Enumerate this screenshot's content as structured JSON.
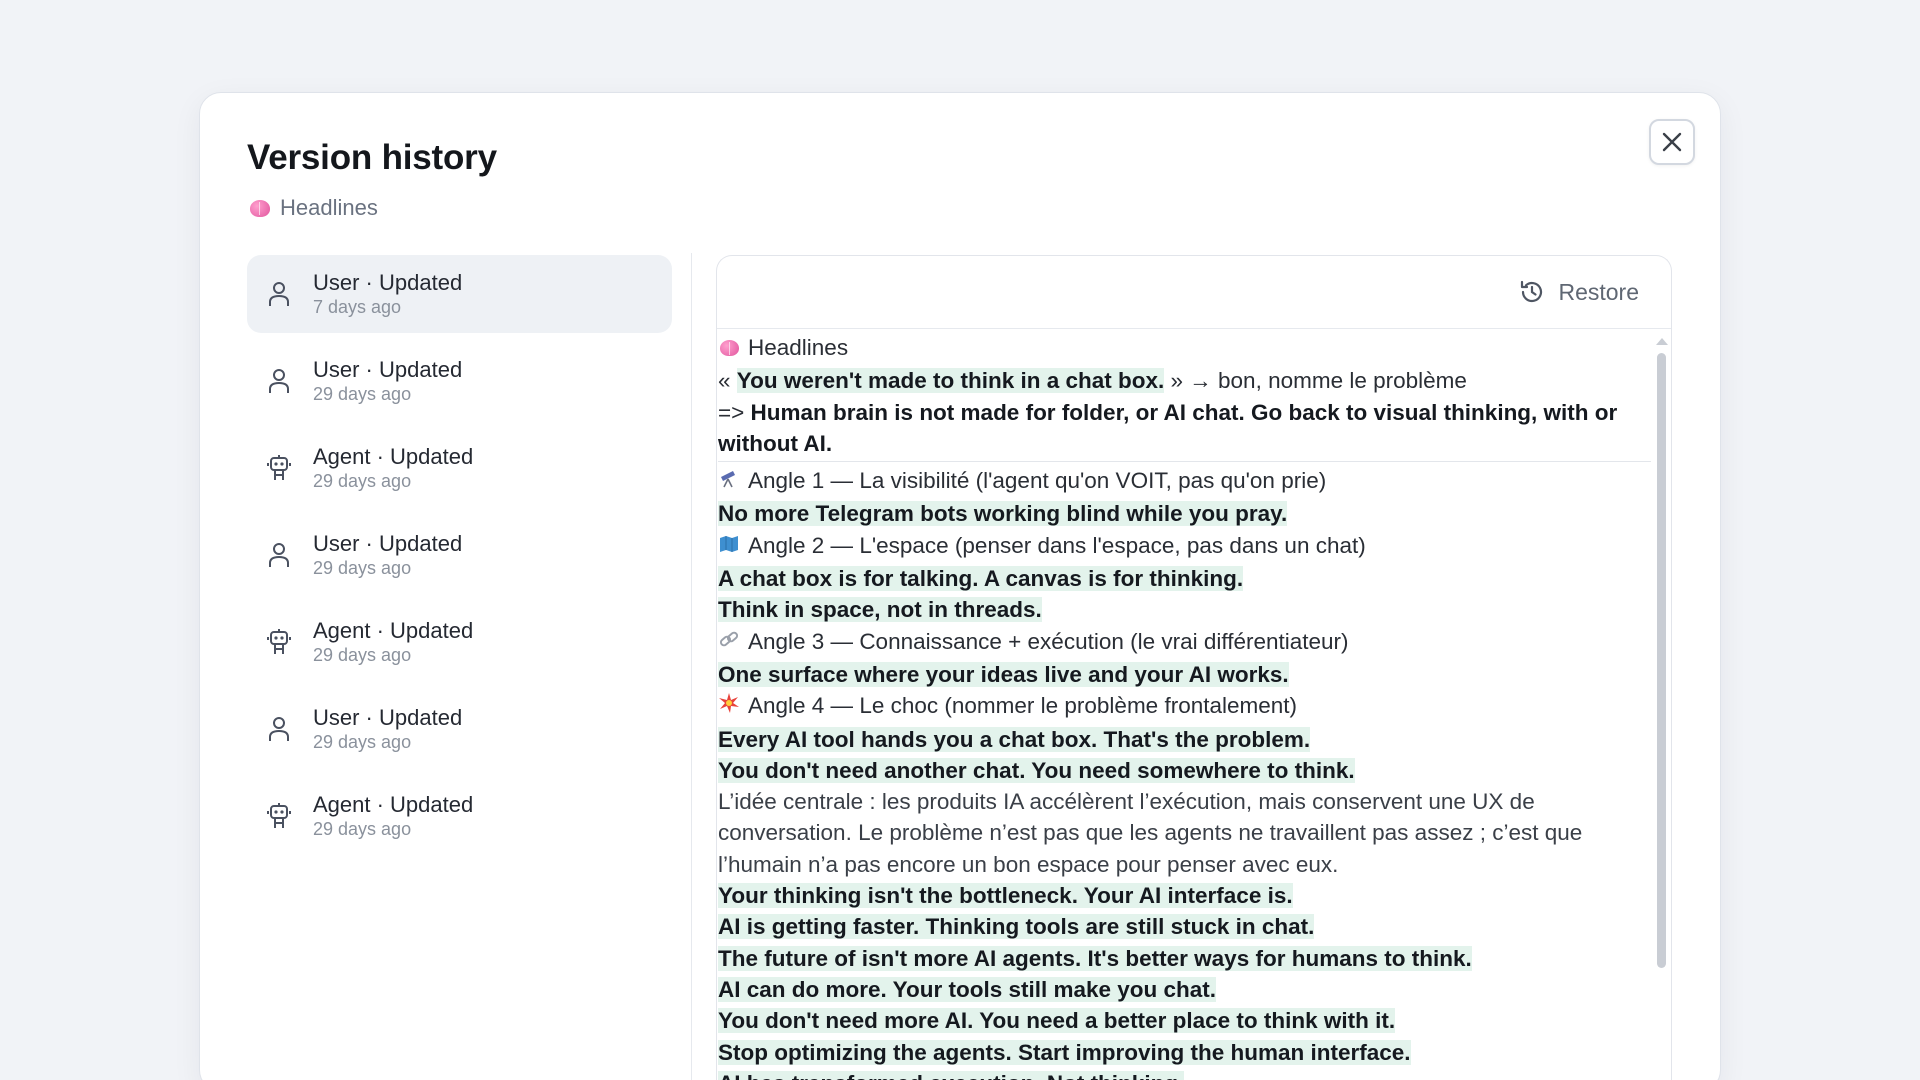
{
  "modal": {
    "title": "Version history",
    "document_name": "Headlines"
  },
  "versions": [
    {
      "actor": "User",
      "label": "User · Updated",
      "time": "7 days ago",
      "icon": "user-icon",
      "active": true
    },
    {
      "actor": "User",
      "label": "User · Updated",
      "time": "29 days ago",
      "icon": "user-icon",
      "active": false
    },
    {
      "actor": "Agent",
      "label": "Agent · Updated",
      "time": "29 days ago",
      "icon": "robot-icon",
      "active": false
    },
    {
      "actor": "User",
      "label": "User · Updated",
      "time": "29 days ago",
      "icon": "user-icon",
      "active": false
    },
    {
      "actor": "Agent",
      "label": "Agent · Updated",
      "time": "29 days ago",
      "icon": "robot-icon",
      "active": false
    },
    {
      "actor": "User",
      "label": "User · Updated",
      "time": "29 days ago",
      "icon": "user-icon",
      "active": false
    },
    {
      "actor": "Agent",
      "label": "Agent · Updated",
      "time": "29 days ago",
      "icon": "robot-icon",
      "active": false
    }
  ],
  "toolbar": {
    "restore_label": "Restore"
  },
  "content": {
    "heading": "Headlines",
    "l1_open": "« ",
    "l1_hl": "You weren't made to think in a chat box.",
    "l1_rest": " » → bon, nomme le problème",
    "l2_prefix": "=> ",
    "l2_bold": "Human brain is not made for folder, or AI chat. Go back to visual thinking, with or without AI.",
    "angle1": "Angle 1 — La visibilité (l'agent qu'on VOIT, pas qu'on prie)",
    "a1_l1": "No more Telegram bots working blind while you pray.",
    "angle2": "Angle 2 — L'espace (penser dans l'espace, pas dans un chat)",
    "a2_l1": "A chat box is for talking. A canvas is for thinking.",
    "a2_l2": "Think in space, not in threads.",
    "angle3": "Angle 3 — Connaissance + exécution (le vrai différentiateur)",
    "a3_l1": "One surface where your ideas live and your AI works.",
    "angle4": "Angle 4 — Le choc (nommer le problème frontalement)",
    "a4_l1": "Every AI tool hands you a chat box. That's the problem.",
    "a4_l2": "You don't need another chat. You need somewhere to think.",
    "idea_para": "L’idée centrale : les produits IA accélèrent l’exécution, mais conservent une UX de conversation. Le problème n’est pas que les agents ne travaillent pas assez ; c’est que l’humain n’a pas encore un bon espace pour penser avec eux.",
    "h1": "Your thinking isn't the bottleneck. Your AI interface is.",
    "h2": "AI is getting faster. Thinking tools are still stuck in chat.",
    "h3": "The future of isn't more AI agents. It's better ways for humans to think.",
    "h4": "AI can do more. Your tools still make you chat.",
    "h5": "You don't need more AI. You need a better place to think with it.",
    "h6": "Stop optimizing the agents. Start improving the human interface.",
    "h7": "AI has transformed execution. Not thinking."
  },
  "icons": {
    "angle1": "telescope-icon",
    "angle2": "map-icon",
    "angle3": "link-icon",
    "angle4": "collision-icon"
  },
  "colors": {
    "highlight": "#e3f3ec",
    "background": "#f1f3f7",
    "active_item": "#eef1f5"
  }
}
